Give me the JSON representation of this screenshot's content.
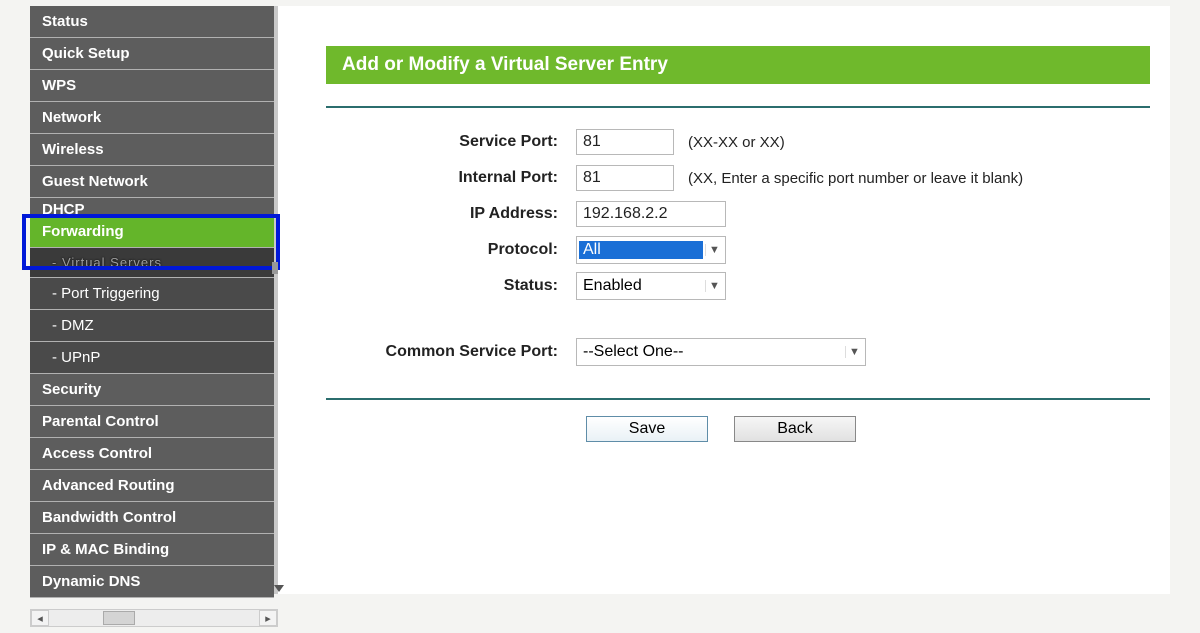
{
  "sidebar": {
    "items": [
      {
        "label": "Status"
      },
      {
        "label": "Quick Setup"
      },
      {
        "label": "WPS"
      },
      {
        "label": "Network"
      },
      {
        "label": "Wireless"
      },
      {
        "label": "Guest Network"
      },
      {
        "label": "DHCP"
      },
      {
        "label": "Forwarding"
      },
      {
        "label": "- Virtual Servers"
      },
      {
        "label": "- Port Triggering"
      },
      {
        "label": "- DMZ"
      },
      {
        "label": "- UPnP"
      },
      {
        "label": "Security"
      },
      {
        "label": "Parental Control"
      },
      {
        "label": "Access Control"
      },
      {
        "label": "Advanced Routing"
      },
      {
        "label": "Bandwidth Control"
      },
      {
        "label": "IP & MAC Binding"
      },
      {
        "label": "Dynamic DNS"
      }
    ]
  },
  "page": {
    "title": "Add or Modify a Virtual Server Entry"
  },
  "form": {
    "service_port_label": "Service Port:",
    "service_port_value": "81",
    "service_port_hint": "(XX-XX or XX)",
    "internal_port_label": "Internal Port:",
    "internal_port_value": "81",
    "internal_port_hint": "(XX, Enter a specific port number or leave it blank)",
    "ip_address_label": "IP Address:",
    "ip_address_value": "192.168.2.2",
    "protocol_label": "Protocol:",
    "protocol_value": "All",
    "status_label": "Status:",
    "status_value": "Enabled",
    "common_service_label": "Common Service Port:",
    "common_service_value": "--Select One--"
  },
  "buttons": {
    "save": "Save",
    "back": "Back"
  }
}
